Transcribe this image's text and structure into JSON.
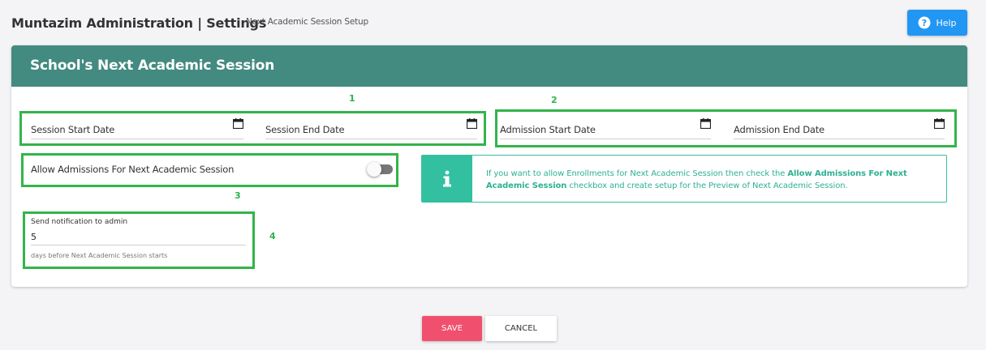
{
  "header": {
    "app_title": "Muntazim Administration | Settings",
    "breadcrumb": "Next Academic Session Setup",
    "help_label": "Help"
  },
  "card": {
    "title": "School's Next Academic Session"
  },
  "annotations": [
    "1",
    "2",
    "3",
    "4"
  ],
  "fields": {
    "session_start": {
      "label": "Session Start Date",
      "value": ""
    },
    "session_end": {
      "label": "Session End Date",
      "value": ""
    },
    "admission_start": {
      "label": "Admission Start Date",
      "value": ""
    },
    "admission_end": {
      "label": "Admission End Date",
      "value": ""
    }
  },
  "toggle": {
    "label": "Allow Admissions For Next Academic Session",
    "checked": false
  },
  "info": {
    "text_before": "If you want to allow Enrollments for Next Academic Session then check the ",
    "text_bold": "Allow Admissions For Next Academic Session",
    "text_after": " checkbox and create setup for the Preview of Next Academic Session."
  },
  "notification": {
    "label": "Send notification to admin",
    "value": "5",
    "hint": "days before Next Academic Session starts"
  },
  "actions": {
    "save_label": "SAVE",
    "cancel_label": "CANCEL"
  },
  "colors": {
    "header_bg": "#438a80",
    "highlight": "#33b44a",
    "info_accent": "#32c0a0",
    "help_button": "#2196f3",
    "save_button": "#f0506e"
  },
  "icons": {
    "help": "question-circle-icon",
    "calendar": "calendar-icon",
    "info": "info-icon"
  }
}
